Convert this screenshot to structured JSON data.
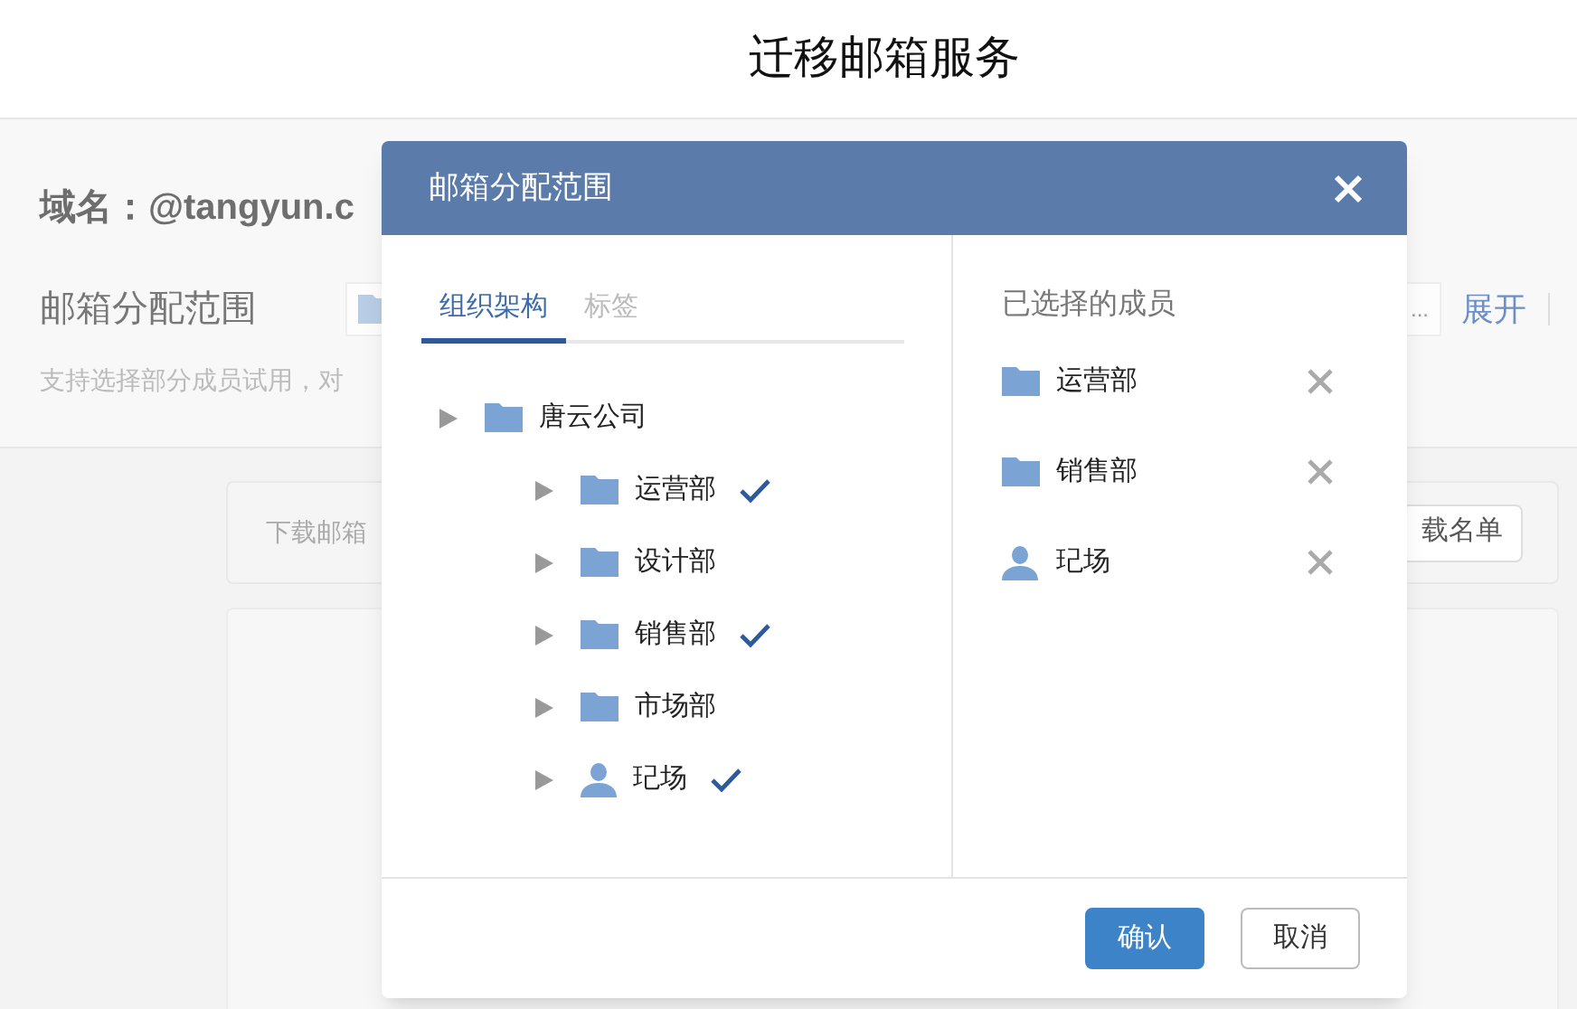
{
  "page": {
    "title": "迁移邮箱服务",
    "domain": "域名：@tangyun.c",
    "scope_label": "邮箱分配范围",
    "scope_field": "...",
    "expand_link": "展开",
    "hint": "支持选择部分成员试用，对",
    "download_text": "下载邮箱",
    "download_button": "载名单"
  },
  "dialog": {
    "title": "邮箱分配范围",
    "tabs": [
      {
        "label": "组织架构",
        "selected": true
      },
      {
        "label": "标签",
        "selected": false
      }
    ],
    "tree": [
      {
        "name": "唐云公司",
        "kind": "folder",
        "checked": false,
        "children": [
          {
            "name": "运营部",
            "kind": "folder",
            "checked": true
          },
          {
            "name": "设计部",
            "kind": "folder",
            "checked": false
          },
          {
            "name": "销售部",
            "kind": "folder",
            "checked": true
          },
          {
            "name": "市场部",
            "kind": "folder",
            "checked": false
          },
          {
            "name": "玘场",
            "kind": "person",
            "checked": true
          }
        ]
      }
    ],
    "selected_title": "已选择的成员",
    "selected_members": [
      {
        "name": "运营部",
        "kind": "folder"
      },
      {
        "name": "销售部",
        "kind": "folder"
      },
      {
        "name": "玘场",
        "kind": "person"
      }
    ],
    "buttons": [
      {
        "label": "确认",
        "kind": "primary"
      },
      {
        "label": "取消",
        "kind": "secondary"
      }
    ]
  }
}
